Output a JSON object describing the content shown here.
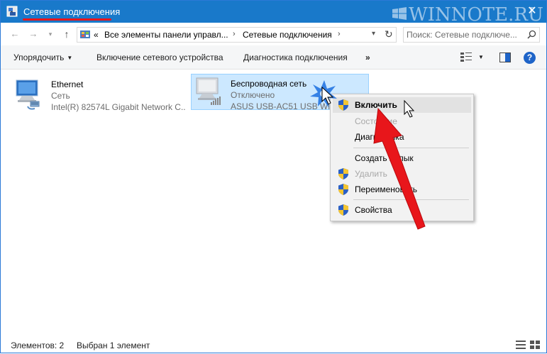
{
  "window": {
    "title": "Сетевые подключения",
    "close_symbol": "✕",
    "watermark": "WINNOTE.RU"
  },
  "address": {
    "chevrons": "«",
    "crumbs": [
      "Все элементы панели управл...",
      "Сетевые подключения"
    ],
    "separator": "›",
    "search_placeholder": "Поиск: Сетевые подключе..."
  },
  "toolbar": {
    "organize": "Упорядочить",
    "enable_device": "Включение сетевого устройства",
    "diagnostics": "Диагностика подключения",
    "more": "»",
    "help": "?"
  },
  "connections": [
    {
      "name": "Ethernet",
      "status": "Сеть",
      "adapter": "Intel(R) 82574L Gigabit Network C...",
      "icon": "ethernet-adapter-icon",
      "selected": false
    },
    {
      "name": "Беспроводная сеть",
      "status": "Отключено",
      "adapter": "ASUS USB-AC51 USB Wir...",
      "icon": "wireless-adapter-icon",
      "selected": true
    }
  ],
  "context_menu": {
    "items": [
      {
        "label": "Включить",
        "shield": true,
        "bold": true,
        "disabled": false,
        "hover": true
      },
      {
        "label": "Состояние",
        "shield": false,
        "bold": false,
        "disabled": true,
        "hover": false
      },
      {
        "label": "Диагностика",
        "shield": false,
        "bold": false,
        "disabled": false,
        "hover": false
      },
      {
        "label": "Создать ярлык",
        "shield": false,
        "bold": false,
        "disabled": false,
        "hover": false
      },
      {
        "label": "Удалить",
        "shield": true,
        "bold": false,
        "disabled": true,
        "hover": false
      },
      {
        "label": "Переименовать",
        "shield": true,
        "bold": false,
        "disabled": false,
        "hover": false
      },
      {
        "label": "Свойства",
        "shield": true,
        "bold": false,
        "disabled": false,
        "hover": false
      }
    ]
  },
  "status": {
    "count": "Элементов: 2",
    "selected": "Выбран 1 элемент"
  },
  "colors": {
    "titlebar": "#1979ca",
    "selection": "#cce8ff",
    "annotation_red": "#e8161b"
  }
}
